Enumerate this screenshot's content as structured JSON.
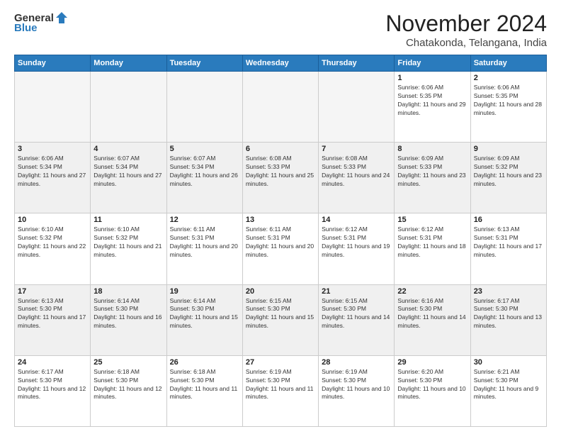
{
  "logo": {
    "general": "General",
    "blue": "Blue"
  },
  "title": "November 2024",
  "location": "Chatakonda, Telangana, India",
  "days_header": [
    "Sunday",
    "Monday",
    "Tuesday",
    "Wednesday",
    "Thursday",
    "Friday",
    "Saturday"
  ],
  "weeks": [
    [
      {
        "day": "",
        "info": ""
      },
      {
        "day": "",
        "info": ""
      },
      {
        "day": "",
        "info": ""
      },
      {
        "day": "",
        "info": ""
      },
      {
        "day": "",
        "info": ""
      },
      {
        "day": "1",
        "info": "Sunrise: 6:06 AM\nSunset: 5:35 PM\nDaylight: 11 hours and 29 minutes."
      },
      {
        "day": "2",
        "info": "Sunrise: 6:06 AM\nSunset: 5:35 PM\nDaylight: 11 hours and 28 minutes."
      }
    ],
    [
      {
        "day": "3",
        "info": "Sunrise: 6:06 AM\nSunset: 5:34 PM\nDaylight: 11 hours and 27 minutes."
      },
      {
        "day": "4",
        "info": "Sunrise: 6:07 AM\nSunset: 5:34 PM\nDaylight: 11 hours and 27 minutes."
      },
      {
        "day": "5",
        "info": "Sunrise: 6:07 AM\nSunset: 5:34 PM\nDaylight: 11 hours and 26 minutes."
      },
      {
        "day": "6",
        "info": "Sunrise: 6:08 AM\nSunset: 5:33 PM\nDaylight: 11 hours and 25 minutes."
      },
      {
        "day": "7",
        "info": "Sunrise: 6:08 AM\nSunset: 5:33 PM\nDaylight: 11 hours and 24 minutes."
      },
      {
        "day": "8",
        "info": "Sunrise: 6:09 AM\nSunset: 5:33 PM\nDaylight: 11 hours and 23 minutes."
      },
      {
        "day": "9",
        "info": "Sunrise: 6:09 AM\nSunset: 5:32 PM\nDaylight: 11 hours and 23 minutes."
      }
    ],
    [
      {
        "day": "10",
        "info": "Sunrise: 6:10 AM\nSunset: 5:32 PM\nDaylight: 11 hours and 22 minutes."
      },
      {
        "day": "11",
        "info": "Sunrise: 6:10 AM\nSunset: 5:32 PM\nDaylight: 11 hours and 21 minutes."
      },
      {
        "day": "12",
        "info": "Sunrise: 6:11 AM\nSunset: 5:31 PM\nDaylight: 11 hours and 20 minutes."
      },
      {
        "day": "13",
        "info": "Sunrise: 6:11 AM\nSunset: 5:31 PM\nDaylight: 11 hours and 20 minutes."
      },
      {
        "day": "14",
        "info": "Sunrise: 6:12 AM\nSunset: 5:31 PM\nDaylight: 11 hours and 19 minutes."
      },
      {
        "day": "15",
        "info": "Sunrise: 6:12 AM\nSunset: 5:31 PM\nDaylight: 11 hours and 18 minutes."
      },
      {
        "day": "16",
        "info": "Sunrise: 6:13 AM\nSunset: 5:31 PM\nDaylight: 11 hours and 17 minutes."
      }
    ],
    [
      {
        "day": "17",
        "info": "Sunrise: 6:13 AM\nSunset: 5:30 PM\nDaylight: 11 hours and 17 minutes."
      },
      {
        "day": "18",
        "info": "Sunrise: 6:14 AM\nSunset: 5:30 PM\nDaylight: 11 hours and 16 minutes."
      },
      {
        "day": "19",
        "info": "Sunrise: 6:14 AM\nSunset: 5:30 PM\nDaylight: 11 hours and 15 minutes."
      },
      {
        "day": "20",
        "info": "Sunrise: 6:15 AM\nSunset: 5:30 PM\nDaylight: 11 hours and 15 minutes."
      },
      {
        "day": "21",
        "info": "Sunrise: 6:15 AM\nSunset: 5:30 PM\nDaylight: 11 hours and 14 minutes."
      },
      {
        "day": "22",
        "info": "Sunrise: 6:16 AM\nSunset: 5:30 PM\nDaylight: 11 hours and 14 minutes."
      },
      {
        "day": "23",
        "info": "Sunrise: 6:17 AM\nSunset: 5:30 PM\nDaylight: 11 hours and 13 minutes."
      }
    ],
    [
      {
        "day": "24",
        "info": "Sunrise: 6:17 AM\nSunset: 5:30 PM\nDaylight: 11 hours and 12 minutes."
      },
      {
        "day": "25",
        "info": "Sunrise: 6:18 AM\nSunset: 5:30 PM\nDaylight: 11 hours and 12 minutes."
      },
      {
        "day": "26",
        "info": "Sunrise: 6:18 AM\nSunset: 5:30 PM\nDaylight: 11 hours and 11 minutes."
      },
      {
        "day": "27",
        "info": "Sunrise: 6:19 AM\nSunset: 5:30 PM\nDaylight: 11 hours and 11 minutes."
      },
      {
        "day": "28",
        "info": "Sunrise: 6:19 AM\nSunset: 5:30 PM\nDaylight: 11 hours and 10 minutes."
      },
      {
        "day": "29",
        "info": "Sunrise: 6:20 AM\nSunset: 5:30 PM\nDaylight: 11 hours and 10 minutes."
      },
      {
        "day": "30",
        "info": "Sunrise: 6:21 AM\nSunset: 5:30 PM\nDaylight: 11 hours and 9 minutes."
      }
    ]
  ]
}
